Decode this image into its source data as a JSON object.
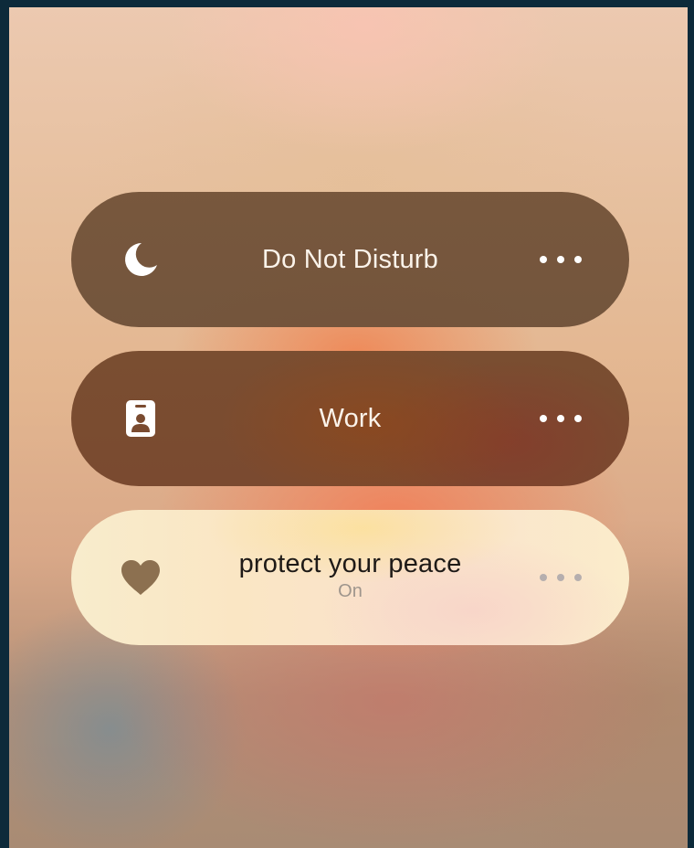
{
  "focus_modes": [
    {
      "label": "Do Not Disturb",
      "status": "",
      "icon": "moon-icon",
      "active": false,
      "more_icon": "ellipsis-icon"
    },
    {
      "label": "Work",
      "status": "",
      "icon": "id-badge-icon",
      "active": false,
      "more_icon": "ellipsis-icon"
    },
    {
      "label": "protect your peace",
      "status": "On",
      "icon": "heart-icon",
      "active": true,
      "more_icon": "ellipsis-icon"
    }
  ],
  "colors": {
    "inactive_pill": "#735438",
    "active_pill": "#f9e8c8",
    "active_icon": "#8c7050",
    "active_title": "#1e1a17",
    "status_text": "#9e958c"
  }
}
